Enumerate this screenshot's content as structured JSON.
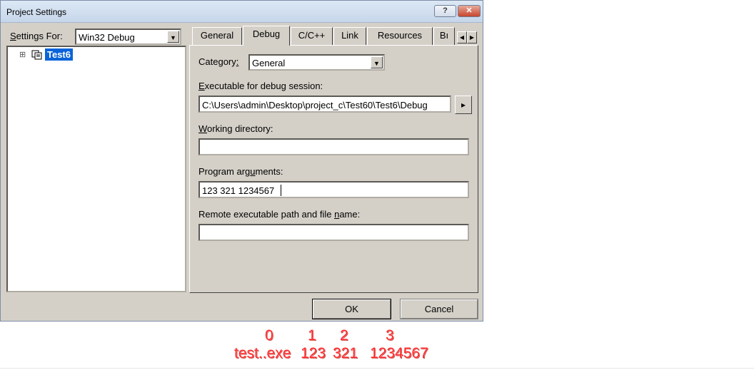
{
  "window": {
    "title": "Project Settings",
    "help_label": "?",
    "close_label": "✕"
  },
  "left_panel": {
    "settings_for_label": "Settings For:",
    "settings_for_value": "Win32 Debug",
    "tree": [
      {
        "label": "Test6",
        "expander": "⊞",
        "selected": true
      }
    ]
  },
  "tabs": [
    {
      "label": "General"
    },
    {
      "label": "Debug",
      "active": true
    },
    {
      "label": "C/C++"
    },
    {
      "label": "Link"
    },
    {
      "label": "Resources"
    },
    {
      "label": "Bı"
    }
  ],
  "tab_scroll": {
    "left": "◀",
    "right": "▶"
  },
  "debug": {
    "category_label": "Category:",
    "category_value": "General",
    "executable_label": "Executable for debug session:",
    "executable_value": "C:\\Users\\admin\\Desktop\\project_c\\Test60\\Test6\\Debug",
    "browse_arrow": "▸",
    "working_dir_label": "Working directory:",
    "working_dir_value": "",
    "program_args_label": "Program arguments:",
    "program_args_value": "123 321 1234567",
    "remote_label": "Remote executable path and file name:",
    "remote_value": ""
  },
  "buttons": {
    "ok": "OK",
    "cancel": "Cancel"
  },
  "annotation": {
    "indices": [
      "0",
      "1",
      "2",
      "3"
    ],
    "args": [
      "test..exe",
      "123",
      "321",
      "1234567"
    ],
    "color": "#ff2a2a"
  }
}
